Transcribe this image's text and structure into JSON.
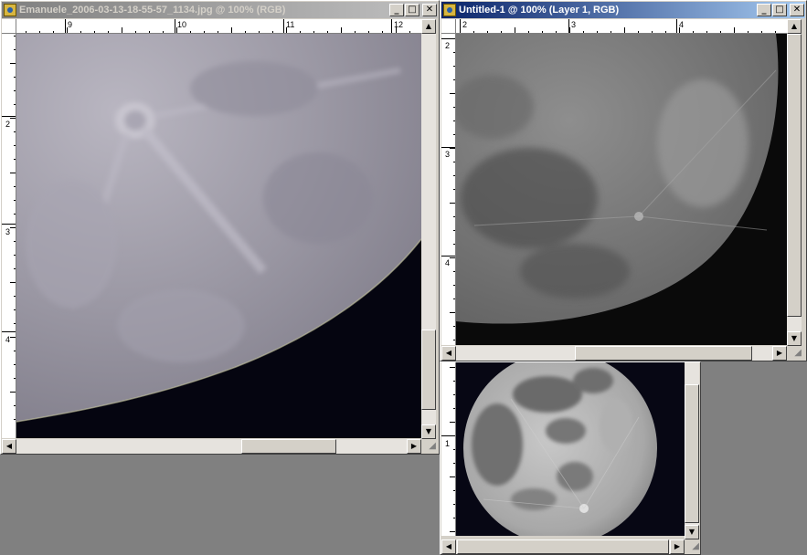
{
  "windows": [
    {
      "id": "doc1",
      "title": "Emanuele_2006-03-13-18-55-57_1134.jpg @ 100% (RGB)",
      "active": false,
      "ruler_h": [
        "9",
        "10",
        "11",
        "12"
      ],
      "ruler_v": [
        "2",
        "3",
        "4"
      ]
    },
    {
      "id": "doc2",
      "title": "Untitled-1 @ 100% (Layer 1, RGB)",
      "active": true,
      "ruler_h": [
        "2",
        "3",
        "4"
      ],
      "ruler_v": [
        "2",
        "3",
        "4"
      ]
    },
    {
      "id": "doc3",
      "title": "",
      "active": false,
      "ruler_h": [],
      "ruler_v": [
        "1"
      ]
    }
  ],
  "titlebar_buttons": {
    "minimize": "_",
    "maximize": "□",
    "close": "✕"
  },
  "scroll_arrows": {
    "up": "▲",
    "down": "▼",
    "left": "◀",
    "right": "▶"
  },
  "icons": {
    "app_icon": "photoshop-document-icon",
    "resize": "resize-grip-icon"
  },
  "colors": {
    "active_title": "#0a246a",
    "inactive_title": "#808080",
    "workspace": "#808080",
    "chrome": "#d4d0c8"
  }
}
